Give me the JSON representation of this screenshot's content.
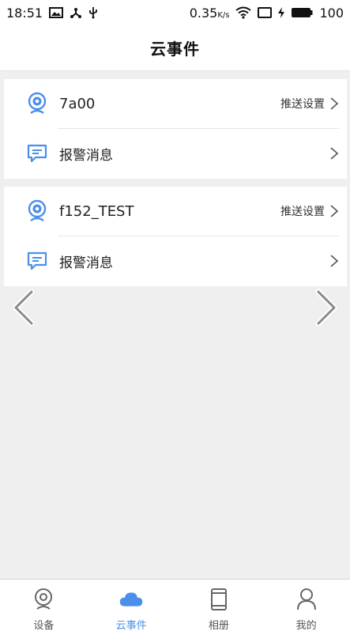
{
  "status_bar": {
    "time": "18:51",
    "speed_value": "0.35",
    "speed_unit": "K/s",
    "battery": "100"
  },
  "header": {
    "title": "云事件"
  },
  "devices": [
    {
      "name": "7a00",
      "push_label": "推送设置",
      "alarm_label": "报警消息"
    },
    {
      "name": "f152_TEST",
      "push_label": "推送设置",
      "alarm_label": "报警消息"
    }
  ],
  "tabs": [
    {
      "label": "设备",
      "icon": "device-pin-icon",
      "active": false
    },
    {
      "label": "云事件",
      "icon": "cloud-icon",
      "active": true
    },
    {
      "label": "相册",
      "icon": "album-icon",
      "active": false
    },
    {
      "label": "我的",
      "icon": "profile-icon",
      "active": false
    }
  ],
  "colors": {
    "accent": "#4b8fea",
    "background": "#efefef"
  }
}
